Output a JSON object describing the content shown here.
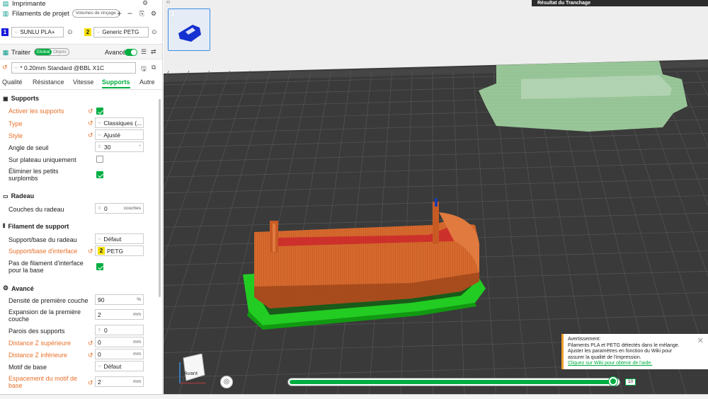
{
  "printer": {
    "title": "Imprimante"
  },
  "filaments": {
    "title": "Filaments de projet",
    "badge": "Volumes de rinçage",
    "items": [
      {
        "num": "1",
        "name": "SUNLU PLA+",
        "color": "#1a1adc"
      },
      {
        "num": "2",
        "name": "Generic PETG",
        "color": "#f5e000"
      }
    ]
  },
  "process": {
    "title": "Traiter",
    "toggle_global": "Global",
    "toggle_objects": "Objets",
    "advanced": "Avancé",
    "preset": "* 0.20mm Standard @BBL X1C"
  },
  "tabs": [
    "Qualité",
    "Résistance",
    "Vitesse",
    "Supports",
    "Autre"
  ],
  "sections": {
    "supports": "Supports",
    "raft": "Radeau",
    "filament": "Filament de support",
    "advanced": "Avancé"
  },
  "rows": {
    "enable": "Activer les supports",
    "type_label": "Type",
    "type_value": "Classiques (...",
    "style_label": "Style",
    "style_value": "Ajusté",
    "threshold_label": "Angle de seuil",
    "threshold_value": "30",
    "threshold_unit": "°",
    "buildplate_label": "Sur plateau uniquement",
    "remove_small_label": "Éliminer les petits surplombs",
    "raft_layers_label": "Couches du radeau",
    "raft_layers_value": "0",
    "raft_layers_unit": "couches",
    "base_label": "Support/base du radeau",
    "base_value": "Défaut",
    "interface_label": "Support/base d'interface",
    "interface_num": "2",
    "interface_value": "PETG",
    "no_filament_label": "Pas de filament d'interface pour la base",
    "first_density_label": "Densité de première couche",
    "first_density_value": "90",
    "first_density_unit": "%",
    "first_expansion_label": "Expansion de la première couche",
    "first_expansion_value": "2",
    "first_expansion_unit": "mm",
    "walls_label": "Parois des supports",
    "walls_value": "0",
    "top_z_label": "Distance Z supérieure",
    "top_z_value": "0",
    "top_z_unit": "mm",
    "bottom_z_label": "Distance Z inférieure",
    "bottom_z_value": "0",
    "bottom_z_unit": "mm",
    "pattern_label": "Motif de base",
    "pattern_value": "Défaut",
    "spacing_label": "Espacement du motif de base",
    "spacing_value": "2",
    "spacing_unit": "mm"
  },
  "viewport": {
    "plate_num": "1",
    "slice_header": "Résultat du Tranchage",
    "cube_label": "Avant",
    "layer_value": "10",
    "layer_progress": 0.99
  },
  "warning": {
    "title": "Avertissement:",
    "line1": "Filaments PLA et PETG détectés dans le mélange.",
    "line2": "Ajuster les paramètres en fonction du Wiki pour",
    "line3": "assurer la qualité de l'impression.",
    "link": "Cliquez sur Wiki pour obtenir de l'aide."
  },
  "colors": {
    "accent": "#00ae42",
    "modified": "#e8702a",
    "support": "#22cc22",
    "model": "#d2691e",
    "other_model": "#8fbf8f"
  }
}
